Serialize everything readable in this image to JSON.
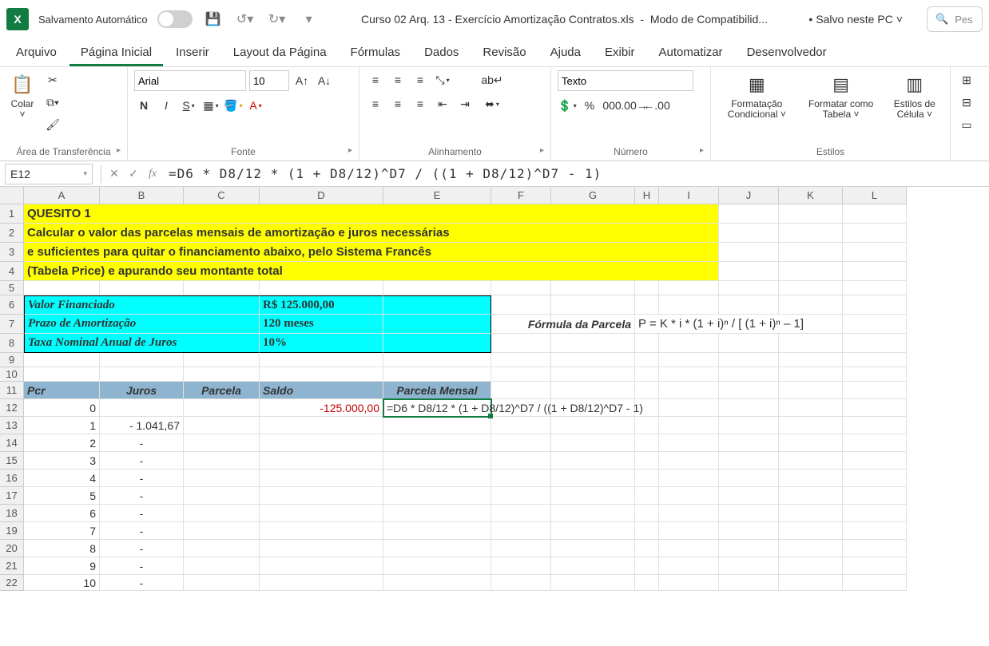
{
  "titlebar": {
    "autosave": "Salvamento Automático",
    "filename": "Curso 02 Arq. 13 - Exercício Amortização Contratos.xls",
    "mode": "Modo de Compatibilid...",
    "save_status": "Salvo neste PC",
    "search_placeholder": "Pes"
  },
  "tabs": {
    "arquivo": "Arquivo",
    "pagina": "Página Inicial",
    "inserir": "Inserir",
    "layout": "Layout da Página",
    "formulas": "Fórmulas",
    "dados": "Dados",
    "revisao": "Revisão",
    "ajuda": "Ajuda",
    "exibir": "Exibir",
    "automatizar": "Automatizar",
    "desenvolvedor": "Desenvolvedor"
  },
  "ribbon": {
    "clipboard": {
      "label": "Área de Transferência",
      "paste": "Colar"
    },
    "font": {
      "label": "Fonte",
      "name": "Arial",
      "size": "10"
    },
    "align": {
      "label": "Alinhamento"
    },
    "number": {
      "label": "Número",
      "format": "Texto"
    },
    "styles": {
      "label": "Estilos",
      "cond": "Formatação Condicional",
      "table": "Formatar como Tabela",
      "cell": "Estilos de Célula"
    }
  },
  "fbar": {
    "namebox": "E12",
    "formula": "=D6 * D8/12 * (1 + D8/12)^D7 / ((1 + D8/12)^D7 - 1)"
  },
  "cols": [
    "A",
    "B",
    "C",
    "D",
    "E",
    "F",
    "G",
    "H",
    "I",
    "J",
    "K",
    "L"
  ],
  "rows": [
    "1",
    "2",
    "3",
    "4",
    "5",
    "6",
    "7",
    "8",
    "9",
    "10",
    "11",
    "12",
    "13",
    "14",
    "15",
    "16",
    "17",
    "18",
    "19",
    "20",
    "21",
    "22"
  ],
  "sheet": {
    "q_title": "QUESITO 1",
    "q_line1": "Calcular o valor das parcelas mensais de amortização e juros necessárias",
    "q_line2": "e suficientes para quitar o financiamento abaixo, pelo Sistema Francês",
    "q_line3": "(Tabela Price) e apurando seu montante total",
    "valor_fin_lbl": "Valor Financiado",
    "valor_fin_val": "R$  125.000,00",
    "prazo_lbl": "Prazo de Amortização",
    "prazo_val": "120 meses",
    "taxa_lbl": "Taxa Nominal Anual de Juros",
    "taxa_val": "10%",
    "formula_lbl": "Fórmula da Parcela",
    "formula_val": "P = K * i * (1 + i)ⁿ / [ (1 + i)ⁿ – 1]",
    "hdr_pcr": "Pcr",
    "hdr_juros": "Juros",
    "hdr_parcela": "Parcela",
    "hdr_saldo": "Saldo",
    "hdr_pm": "Parcela Mensal",
    "r12_a": "0",
    "r12_d": "-125.000,00",
    "r12_e": "=D6 * D8/12 * (1 + D8/12)^D7 / ((1 + D8/12)^D7 - 1)",
    "r13_a": "1",
    "r13_b": "-   1.041,67",
    "r14_a": "2",
    "dash": "-",
    "r15_a": "3",
    "r16_a": "4",
    "r17_a": "5",
    "r18_a": "6",
    "r19_a": "7",
    "r20_a": "8",
    "r21_a": "9",
    "r22_a": "10"
  }
}
